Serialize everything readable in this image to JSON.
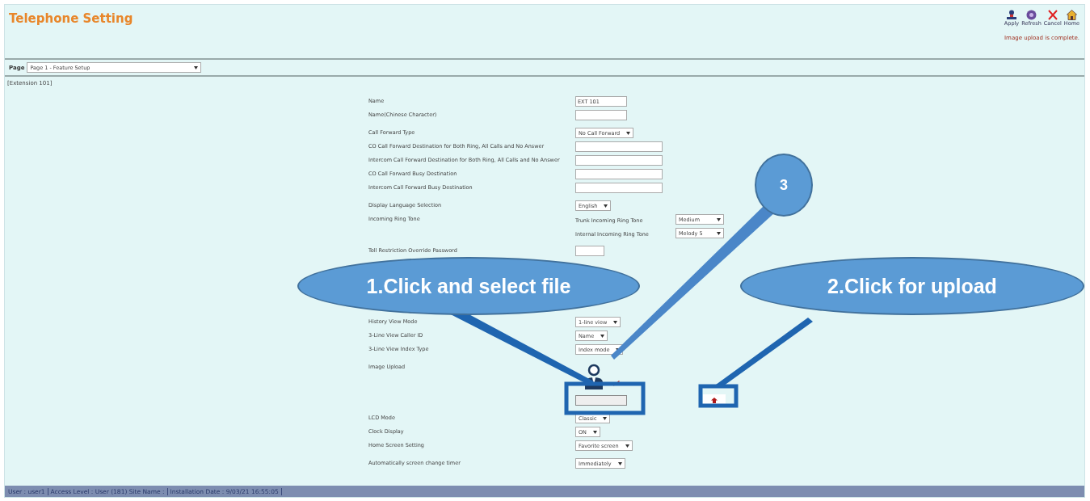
{
  "header": {
    "title": "Telephone Setting",
    "toolbar": [
      {
        "kind": "apply",
        "label": "Apply"
      },
      {
        "kind": "refresh",
        "label": "Refresh"
      },
      {
        "kind": "cancel",
        "label": "Cancel"
      },
      {
        "kind": "home",
        "label": "Home"
      }
    ],
    "message": "Image upload is complete."
  },
  "page_selector": {
    "label": "Page",
    "value": "Page 1 - Feature Setup"
  },
  "section": "[Extension 101]",
  "groups": [
    [
      {
        "kind": "text",
        "label": "Name",
        "value": "EXT 101"
      },
      {
        "kind": "text",
        "label": "Name(Chinese Character)"
      }
    ],
    [
      {
        "kind": "select",
        "label": "Call Forward Type",
        "value": "No Call Forward"
      },
      {
        "kind": "wide-text",
        "label": "CO Call Forward Destination for Both Ring, All Calls and No Answer"
      },
      {
        "kind": "wide-text",
        "label": "Intercom Call Forward Destination for Both Ring, All Calls and No Answer"
      },
      {
        "kind": "wide-text",
        "label": "CO Call Forward Busy Destination"
      },
      {
        "kind": "wide-text",
        "label": "Intercom Call Forward Busy Destination"
      }
    ],
    [
      {
        "kind": "select",
        "label": "Display Language Selection",
        "value": "English"
      },
      {
        "kind": "ringtone",
        "label": "Incoming Ring Tone",
        "tones": [
          {
            "label": "Trunk Incoming Ring Tone",
            "value": "Medium"
          },
          {
            "label": "Internal Incoming Ring Tone",
            "value": "Melody 5"
          }
        ]
      }
    ],
    [
      {
        "kind": "pin",
        "label": "Toll Restriction Override Password"
      }
    ],
    [
      {
        "kind": "select",
        "label": "History View Mode",
        "value": "1-line view"
      },
      {
        "kind": "select",
        "label": "3-Line View Caller ID",
        "value": "Name"
      },
      {
        "kind": "select",
        "label": "3-Line View Index Type",
        "value": "Index mode"
      }
    ],
    [
      {
        "kind": "image",
        "label": "Image Upload"
      }
    ],
    [
      {
        "kind": "select",
        "label": "LCD Mode",
        "value": "Classic"
      },
      {
        "kind": "select",
        "label": "Clock Display",
        "value": "ON"
      },
      {
        "kind": "select",
        "label": "Home Screen Setting",
        "value": "Favorite screen"
      }
    ],
    [
      {
        "kind": "select",
        "label": "Automatically screen change timer",
        "value": "Immediately"
      }
    ]
  ],
  "callouts": [
    {
      "kind": "select-file",
      "text": "1.Click and select file"
    },
    {
      "kind": "upload",
      "text": "2.Click for upload"
    },
    {
      "kind": "number",
      "text": "3"
    }
  ],
  "status_bar": [
    "User : user1",
    "Access Level : User (181) Site Name :",
    "Installation Date : 9/03/21 16:55:05"
  ]
}
